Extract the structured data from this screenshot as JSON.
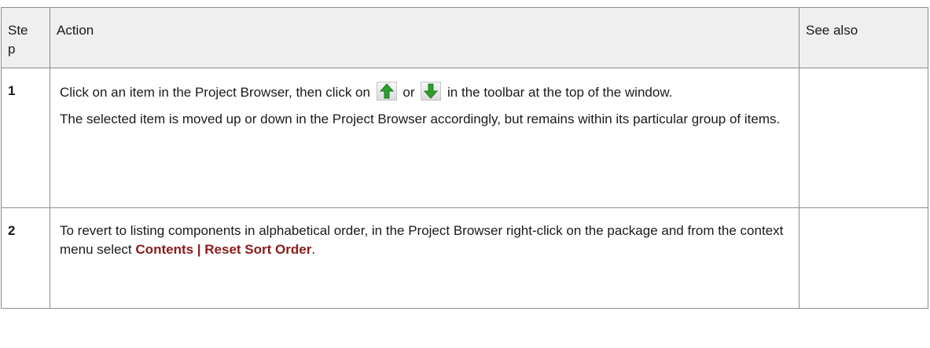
{
  "header": {
    "step": "Step",
    "action": "Action",
    "see_also": "See also"
  },
  "rows": [
    {
      "number": "1",
      "text_before_icons": "Click on an item in the Project Browser, then click on",
      "text_between_icons": "or",
      "text_after_icons": "in the toolbar at the top of the window.",
      "result": "The selected item is moved up or down in the Project Browser accordingly, but remains within its particular group of items.",
      "see_also": "",
      "icons": [
        "move-up-arrow-icon",
        "move-down-arrow-icon"
      ]
    },
    {
      "number": "2",
      "text_before": "To revert to listing components in alphabetical order, in the Project Browser right-click on the package and from the context menu select",
      "menu_path": "Contents | Reset Sort Order",
      "text_after": ".",
      "see_also": ""
    }
  ],
  "colors": {
    "border": "#8c8c8c",
    "header_bg": "#efefef",
    "menu_text": "#8b1a1a",
    "arrow_green": "#2e9e2e"
  }
}
